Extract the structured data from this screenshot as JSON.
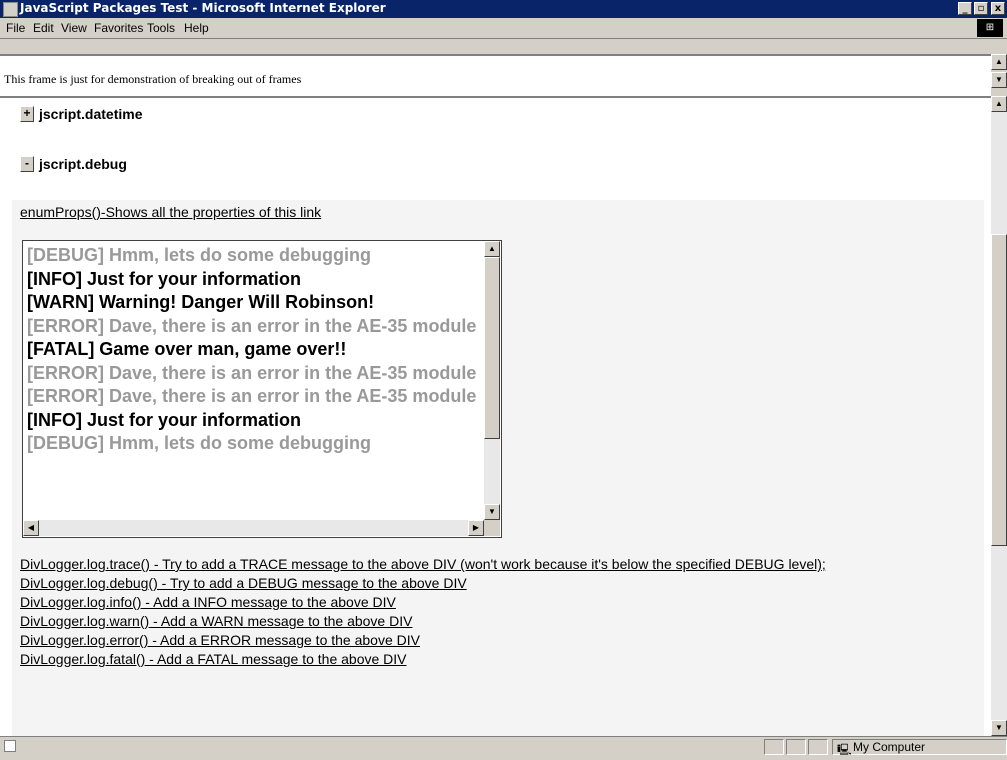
{
  "window": {
    "title": "JavaScript Packages Test - Microsoft Internet Explorer",
    "min_btn": "_",
    "max_btn": "▫",
    "close_btn": "x"
  },
  "menu": [
    "File",
    "Edit",
    "View",
    "Favorites",
    "Tools",
    "Help"
  ],
  "top_frame": {
    "text": "This frame is just for demonstration of breaking out of frames"
  },
  "packages": [
    {
      "toggle": "+",
      "name": "jscript.datetime"
    },
    {
      "toggle": "-",
      "name": "jscript.debug"
    }
  ],
  "enum_link": "enumProps()-Shows all the properties of this link",
  "log_entries": [
    {
      "text": "[DEBUG] Hmm, lets do some debugging",
      "level": "debug"
    },
    {
      "text": "[INFO] Just for your information",
      "level": "info"
    },
    {
      "text": "[WARN] Warning! Danger Will Robinson!",
      "level": "warn"
    },
    {
      "text": "[ERROR] Dave, there is an error in the AE-35 module",
      "level": "error"
    },
    {
      "text": "[FATAL] Game over man, game over!!",
      "level": "fatal"
    },
    {
      "text": "[ERROR] Dave, there is an error in the AE-35 module",
      "level": "error"
    },
    {
      "text": "[ERROR] Dave, there is an error in the AE-35 module",
      "level": "error"
    },
    {
      "text": "[INFO] Just for your information",
      "level": "info"
    },
    {
      "text": "[DEBUG] Hmm, lets do some debugging",
      "level": "debug"
    }
  ],
  "actions": [
    "DivLogger.log.trace() - Try to add a TRACE message to the above DIV (won't work because it's below the specified DEBUG level);",
    "DivLogger.log.debug() - Try to add a DEBUG message to the above DIV",
    "DivLogger.log.info() - Add a INFO message to the above DIV",
    "DivLogger.log.warn() - Add a WARN message to the above DIV",
    "DivLogger.log.error() - Add a ERROR message to the above DIV",
    "DivLogger.log.fatal() - Add a FATAL message to the above DIV"
  ],
  "status": {
    "zone": "My Computer"
  },
  "colors": {
    "title_bar": "#0a246a",
    "chrome": "#d4d0c8",
    "log_muted": "#999999"
  },
  "icons": [
    "ie-icon",
    "windows-logo-icon",
    "computer-icon",
    "page-icon"
  ]
}
